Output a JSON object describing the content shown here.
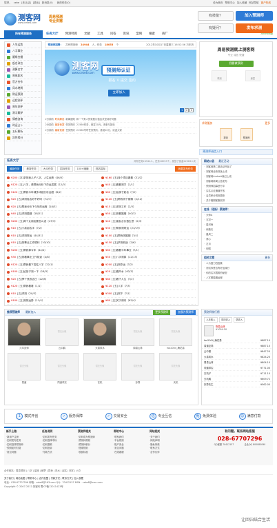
{
  "topbar": {
    "left": [
      "您好，",
      "ceke",
      "[未认证]",
      "[退出]",
      "新消息(0)",
      "",
      "我的任务(0)"
    ],
    "right": [
      "设为首页",
      "帮助中心",
      "加入收藏",
      "网站导航",
      "客户热线"
    ]
  },
  "logo": {
    "name": "测客网",
    "url": "www.ceke8.com"
  },
  "slogan": [
    "周易预测",
    "专业供需"
  ],
  "header": {
    "ask1": "有技能？",
    "go1": "加入预测师",
    "ask2": "有疑问？",
    "go2": "发布求测"
  },
  "nav": {
    "category": "所有预测服务",
    "items": [
      "任务大厅",
      "预测师库",
      "文献",
      "工具",
      "问答",
      "资讯",
      "案例",
      "搜索",
      "商厂"
    ],
    "android": "Android版"
  },
  "sidebar": [
    "人生运势",
    "八字事业",
    "姻缘合婚",
    "起名改名",
    "测算名字",
    "周易起名",
    "官方合作",
    "风水堪舆",
    "财运预测",
    "运程测评",
    "周年测评",
    "测字解梦",
    "情感咨询",
    "时运占卜",
    "五行解析",
    "异性缘分"
  ],
  "stat": {
    "label": "预测师招聘：",
    "total_label": "共有预测师",
    "total": "24944",
    "unit": "人，任务",
    "tasks": "18053",
    "tail": "个",
    "date": "2012年10月17日星期三 16:52:56 万年历"
  },
  "banner": {
    "logo": "测客网",
    "url": "www.ceke8.com",
    "cert": "预测师认证",
    "pills": [
      "报名",
      "V",
      "提交",
      "签约"
    ],
    "join": "立即加入",
    "pages": [
      "1",
      "2",
      "3"
    ]
  },
  "news": [
    [
      "2分钟前",
      "时尚解答",
      "新闻通知",
      "和一个男人的家庭价值否决坚持好问题"
    ],
    [
      "2分钟前",
      "最新竞赛",
      "任务预约",
      "21560任务，悬赏20元，请参与投标"
    ],
    [
      "2分钟前",
      "最新竞赛",
      "任务预约",
      "21560号时任务预约，悬赏20元，欢迎大家"
    ]
  ],
  "recruit": {
    "title": "周易预测就上测客网",
    "sub": "专业 诚信 快捷",
    "go": "我要做预测",
    "icons": [
      "求测",
      "悬赏"
    ]
  },
  "hire": {
    "h1": "求测服务",
    "h2": "更多",
    "tabs": [
      "求测",
      "预测师"
    ]
  },
  "entry": "预测师诚信入口",
  "tasks": {
    "title": "任务大厅",
    "count": "共有任务24944人，任务18053个，发放了赏金22383人次",
    "tabs": [
      "最新任务",
      "悬赏任务",
      "大众任务",
      "招标任务",
      "100+赚赚",
      "进站招标",
      "我要发布任务"
    ],
    "left": [
      [
        "¥200",
        "[本]求测我儿子八字，人生运势（46/5）"
      ],
      [
        "¥120",
        "[五]八字，请帮我分析下命运发展（12/3）"
      ],
      [
        "¥120",
        "[五]帮我今年请多详细分析运程（8/2）"
      ],
      [
        "¥20",
        "[五]求测姓名好不好吗（72/7）"
      ],
      [
        "¥20",
        "[五]帮我分析下今年的运程（18/3）"
      ],
      [
        "¥40",
        "[五]求测婚姻（18/21）"
      ],
      [
        "¥200",
        "[五]两个女朋友要怎么选（47/3）"
      ],
      [
        "¥10",
        "[五]小孩起名字（?/2）"
      ],
      [
        "¥10",
        "[五]求测财运（44/31）"
      ],
      [
        "¥10",
        "[五]测事业工作顺利（10/10）"
      ],
      [
        "¥200",
        "[五]帮我算今年（44/4）"
      ],
      [
        "¥30",
        "[五]测看事业工作前途（4/8）"
      ],
      [
        "¥120",
        "[五]帮我看下四柱八字（22/1）"
      ],
      [
        "¥100",
        "[五]给孩子测一下（18/3）"
      ],
      [
        "¥20",
        "[五]择个良辰吉日（22/8）"
      ],
      [
        "¥120",
        "[五]帮我看看（1/1）"
      ],
      [
        "¥10",
        "[五]求测（20/3）"
      ],
      [
        "¥100",
        "[五]测测运势（11/4）"
      ]
    ],
    "right": [
      [
        "¥160",
        "[五]找个项目看看（31/2）"
      ],
      [
        "¥40",
        "[五]看看测字（1/1）"
      ],
      [
        "¥60",
        "[五]给孩子起名（?/2）"
      ],
      [
        "¥120",
        "[五]帮我测下感情（2/12）"
      ],
      [
        "¥15",
        "[五]求测工作（2/3）"
      ],
      [
        "¥50",
        "[五]测看婚姻（40/3）"
      ],
      [
        "¥40",
        "[五]朋友合伙做生意（2/3）"
      ],
      [
        "¥30",
        "[五]帮我测财运（23/19）"
      ],
      [
        "¥100",
        "[五]帮我测婚姻（?/4）"
      ],
      [
        "¥150",
        "[五]求测前途（2/6）"
      ],
      [
        "¥60",
        "[五]看看今年事业（?/1）"
      ],
      [
        "¥50",
        "[五]八字测算（12/13）"
      ],
      [
        "¥200",
        "[五]测命运（?/2）"
      ],
      [
        "¥20",
        "[五]看风水（62/3）"
      ],
      [
        "¥80",
        "[五]看下人生（?/2）"
      ],
      [
        "¥120",
        "[五]八字（?/3）"
      ],
      [
        "¥300",
        "[五]测下（?/1）"
      ],
      [
        "¥80",
        "[五]关于请问（62/4）"
      ]
    ]
  },
  "announce": {
    "tabs": [
      "网站公告",
      "最近活动"
    ],
    "items": [
      "测客网第二期活动开始了",
      "测客网全新改版上线",
      "测客网Android版已上线",
      "测客网新闻公告发布",
      "预测师招募进行中",
      "实名认证通道开放",
      "会员积分规则更新",
      "关于假期客服安排"
    ]
  },
  "online": {
    "title": "在线（活跃）预测师：",
    "items": [
      "大师A",
      "玄冥一",
      "星河雨",
      "雨落天",
      "晨风二",
      "清心",
      "古月",
      "明镜"
    ]
  },
  "related": {
    "title": "相关文章",
    "more": "更多",
    "items": [
      "人为因力四因素",
      "测试你是否有好运缘分",
      "你的名字藏着的秘密",
      "八字看婚姻运程"
    ]
  },
  "photos": {
    "tabs": [
      "推荐预测师",
      "最新加入"
    ],
    "b1": "更多预测师",
    "b2": "加我为预测师",
    "cells": [
      [
        "六爻卦师",
        true
      ],
      [
        "云中鹤",
        false
      ],
      [
        "大易风水",
        true
      ],
      [
        "周易山林",
        false
      ],
      [
        "fox2004_梅花易",
        false
      ],
      [
        "易道",
        false
      ],
      [
        "同道求实",
        false
      ],
      [
        "玄机",
        false
      ],
      [
        "妙算",
        false
      ],
      [
        "天机",
        false
      ]
    ]
  },
  "ranking": {
    "title": "预测师排行榜",
    "tabs": [
      "上月收入",
      "本月收入",
      "总收入"
    ],
    "top": {
      "name": "陈易山林",
      "v": "¥1054.50"
    },
    "rows": [
      [
        "fox2004_梅花易",
        "¥887.10"
      ],
      [
        "易道至简",
        "¥887.10"
      ],
      [
        "云中鹤",
        "¥847.20"
      ],
      [
        "大易风水",
        "¥824.20"
      ],
      [
        "周易山林",
        "¥804.10"
      ],
      [
        "同道求实",
        "¥771.00"
      ],
      [
        "玄机子",
        "¥711.10"
      ],
      [
        "天机阁",
        "¥609.72"
      ],
      [
        "妙算先生",
        "¥562.00"
      ]
    ]
  },
  "ensure": [
    "模式开创",
    "服务保障",
    "交易安全",
    "专业互信",
    "免费体验",
    "满意付款"
  ],
  "footer": {
    "cols": [
      [
        "新手上路",
        "·新用户注册",
        "·如何发布任务",
        "·如何选择预测师",
        "·预测如何付费",
        "·常见问题"
      ],
      [
        "任务说明",
        "·如何发布任务",
        "·如何选择中标",
        "·如何退款",
        "·如何投诉",
        "·付款方式"
      ],
      [
        "预测师相关",
        "·如何成为预测师",
        "·预测师规则",
        "·预测师积分",
        "·提现规则",
        "·收费标准"
      ],
      [
        "帮助中心",
        "·联系我们",
        "·平台规则",
        "·账户安全",
        "·常见问题",
        "·在线客服"
      ],
      [
        "网站相关",
        "·关于我们",
        "·网站声明",
        "·隐私条款",
        "·联系方式",
        "·合作伙伴"
      ]
    ],
    "contact": "有问题，联系网站客服",
    "tel": "028-67707296",
    "qq": [
      "QQ客服 70412157",
      "企业QQ 800080090"
    ]
  },
  "partners": "合作网站：周易预测 | 八字 | 星座 | 解梦 | 算命 | 风水 | 起名 | 测字 | 六爻",
  "copy": {
    "links": "关于我们 | 网站地图 | 帮助中心 | 合作加盟 | 付款方式 | 联系方式 | 加入收藏",
    "l2": "电话：028-67707296  邮箱：ceke8@163.com  QQ：70412157  MSN：ceke8@msn.com",
    "l3": "Copyright © 2007-2012 测客网 蜀ICP备12011423号"
  },
  "watermark": "让回归结合生活"
}
